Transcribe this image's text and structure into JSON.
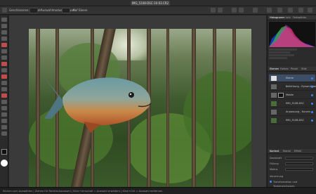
{
  "window": {
    "document_title": "IMG_5108-DSC-10-03.CR2"
  },
  "context_toolbar": {
    "items": [
      "Geschlossene Auswahl",
      "Auswahlmodus: Auswahl",
      "Auf Ebene"
    ]
  },
  "panels": {
    "top_tabs": [
      "Histogramm",
      "Info",
      "Farbwähler"
    ],
    "mid_tabs": [
      "Ebenen",
      "Farben",
      "Pinsel",
      "Stile"
    ],
    "layers": [
      {
        "name": "Ebene",
        "selected": true
      },
      {
        "name": "Belichtung - Dynamikbereich"
      },
      {
        "name": "Maske"
      },
      {
        "name": "IMG_5108-DSC"
      },
      {
        "name": "Anpassung - Kurven"
      },
      {
        "name": "IMG_5108-DSC"
      }
    ],
    "bottom_tabs": [
      "Kontext",
      "Ebene",
      "Effekt"
    ],
    "props": [
      {
        "label": "Deckkraft",
        "value": "100%"
      },
      {
        "label": "Füllung",
        "value": "Standard"
      },
      {
        "label": "Modus",
        "value": "Normal"
      }
    ],
    "sections": [
      "Verzerrung",
      "Transformation und Texteinstellungen"
    ]
  },
  "statusbar": {
    "text": "Klicken zum Auswählen | Ziehen für Rechteckauswahl | Klick+Umschalt = Auswahl erweitern | Klick+Ctrl = Auswahl entfernen"
  },
  "colors": {
    "accent": "#3b82f6",
    "selection": "#3d4f66",
    "tool_highlight": "#c24b4b"
  }
}
